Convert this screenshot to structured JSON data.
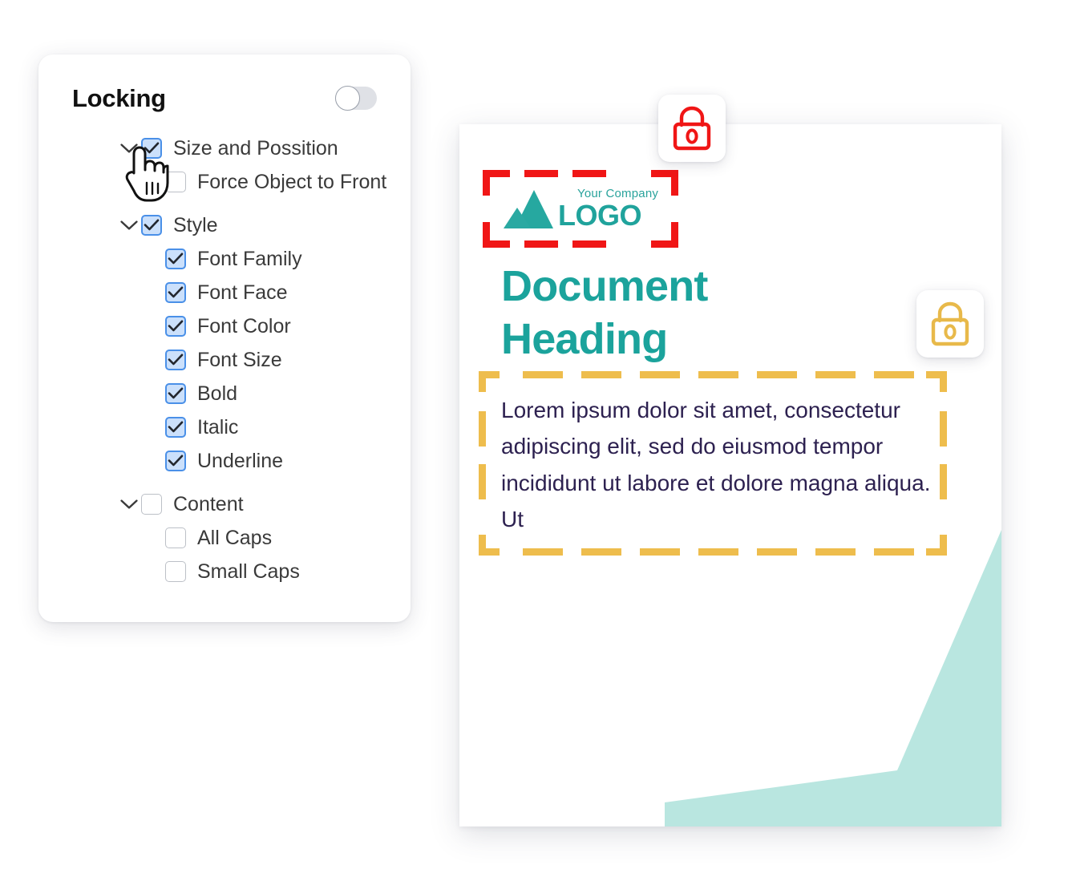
{
  "panel": {
    "title": "Locking",
    "toggle": {
      "name": "locking-toggle",
      "state": "off"
    },
    "tree": [
      {
        "label": "Size and Possition",
        "level": "group",
        "checked": true,
        "chevron": "chevron-down-icon"
      },
      {
        "label": "Force Object to Front",
        "level": "child",
        "checked": false,
        "chevron": ""
      },
      {
        "label": "Style",
        "level": "group",
        "checked": true,
        "chevron": "chevron-down-icon"
      },
      {
        "label": "Font Family",
        "level": "child",
        "checked": true,
        "chevron": ""
      },
      {
        "label": "Font Face",
        "level": "child",
        "checked": true,
        "chevron": ""
      },
      {
        "label": "Font Color",
        "level": "child",
        "checked": true,
        "chevron": ""
      },
      {
        "label": "Font Size",
        "level": "child",
        "checked": true,
        "chevron": ""
      },
      {
        "label": "Bold",
        "level": "child",
        "checked": true,
        "chevron": ""
      },
      {
        "label": "Italic",
        "level": "child",
        "checked": true,
        "chevron": ""
      },
      {
        "label": "Underline",
        "level": "child",
        "checked": true,
        "chevron": ""
      },
      {
        "label": "Content",
        "level": "group",
        "checked": false,
        "chevron": "chevron-down-icon"
      },
      {
        "label": "All Caps",
        "level": "child",
        "checked": false,
        "chevron": ""
      },
      {
        "label": "Small Caps",
        "level": "child",
        "checked": false,
        "chevron": ""
      }
    ]
  },
  "cursor": {
    "icon": "pointer-hand-cursor"
  },
  "document": {
    "logo": {
      "company": "Your Company",
      "word": "LOGO",
      "mark": "mountain-logo-icon",
      "selection_color": "#f01616"
    },
    "heading": "Document Heading",
    "body": "Lorem ipsum dolor sit amet, consectetur adipiscing elit, sed do eiusmod tempor incididunt ut labore et dolore magna aliqua. Ut",
    "body_selection_color": "#eebd4d",
    "decoration": "teal-corner-shape"
  },
  "badges": [
    {
      "name": "lock-badge-red",
      "icon": "lock-icon",
      "color": "#f01616"
    },
    {
      "name": "lock-badge-yellow",
      "icon": "lock-icon",
      "color": "#e8b94a"
    }
  ],
  "colors": {
    "checkbox_accent": "#4a90e8",
    "checkbox_fill": "#cbe0fb",
    "teal": "#1ba39c",
    "teal_light": "#b9e6e0",
    "yellow": "#eebd4d",
    "red": "#f01616",
    "body_text": "#2d2150"
  }
}
